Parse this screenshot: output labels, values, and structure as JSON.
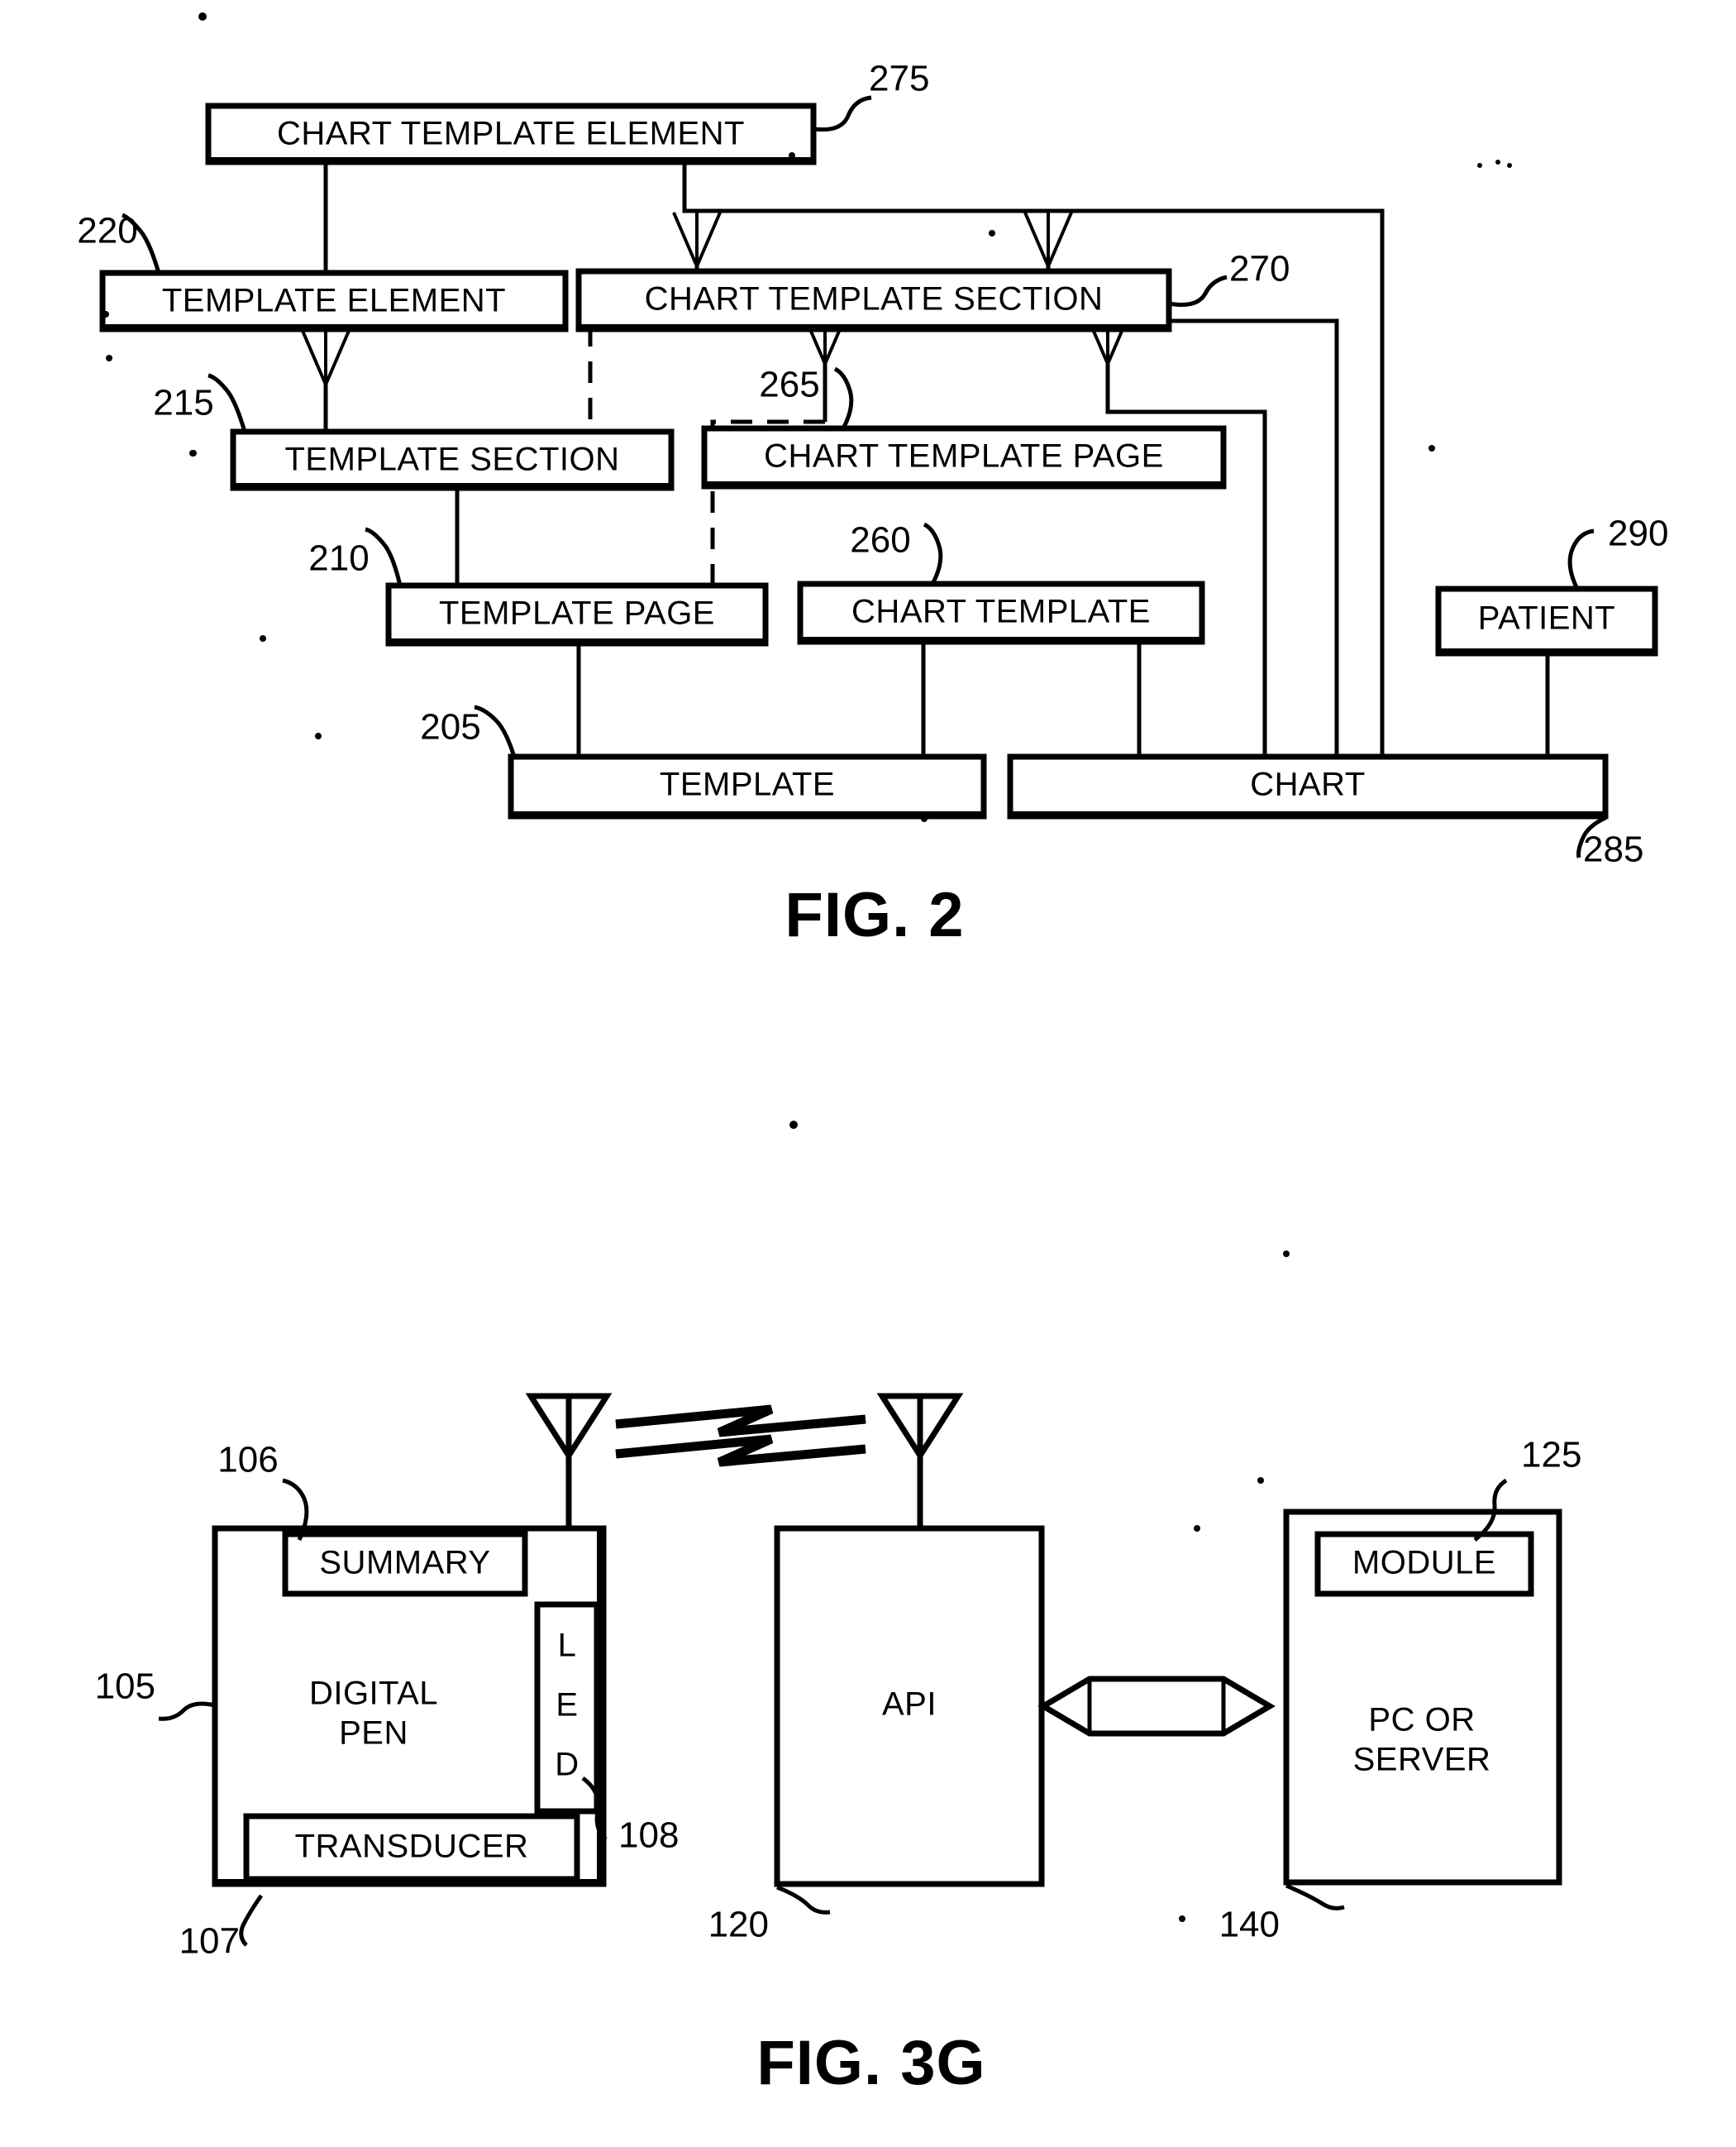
{
  "figures": [
    {
      "id": "fig2",
      "caption": "FIG. 2",
      "boxes": {
        "chart_template_element": "CHART TEMPLATE ELEMENT",
        "template_element": "TEMPLATE ELEMENT",
        "chart_template_section": "CHART TEMPLATE SECTION",
        "template_section": "TEMPLATE SECTION",
        "chart_template_page": "CHART TEMPLATE PAGE",
        "template_page": "TEMPLATE PAGE",
        "chart_template": "CHART TEMPLATE",
        "patient": "PATIENT",
        "template": "TEMPLATE",
        "chart": "CHART"
      },
      "refs": {
        "chart_template_element": "275",
        "template_element": "220",
        "chart_template_section": "270",
        "template_section": "215",
        "chart_template_page": "265",
        "template_page": "210",
        "chart_template": "260",
        "patient": "290",
        "template": "205",
        "chart": "285"
      }
    },
    {
      "id": "fig3g",
      "caption": "FIG. 3G",
      "boxes": {
        "summary": "SUMMARY",
        "digital_pen_line1": "DIGITAL",
        "digital_pen_line2": "PEN",
        "led_l": "L",
        "led_e": "E",
        "led_d": "D",
        "transducer": "TRANSDUCER",
        "api": "API",
        "module": "MODULE",
        "pc_or_server_line1": "PC OR",
        "pc_or_server_line2": "SERVER"
      },
      "refs": {
        "summary": "106",
        "digital_pen": "105",
        "led": "108",
        "transducer": "107",
        "api": "120",
        "module": "125",
        "pc_or_server": "140"
      }
    }
  ],
  "colors": {
    "ink": "#000000",
    "paper": "#ffffff"
  }
}
